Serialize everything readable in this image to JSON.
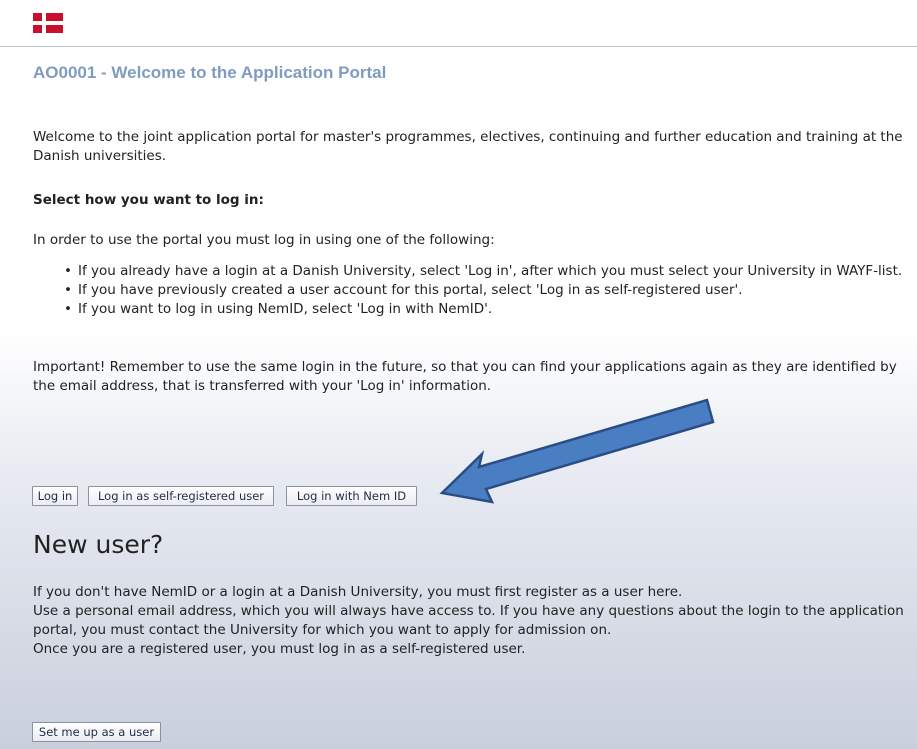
{
  "header": {
    "flag_icon": "denmark-flag-icon",
    "colors": {
      "flag_red": "#c8102e",
      "flag_white": "#ffffff"
    }
  },
  "page": {
    "title": "AO0001 - Welcome to the Application Portal",
    "intro": "Welcome to the joint application portal for master's programmes, electives, continuing and further education and training at the Danish universities.",
    "login_heading": "Select how you want to log in:",
    "instruction": "In order to use the portal you must log in using one of the following:",
    "options": [
      "If you already have a login at a Danish University, select 'Log in', after which you must select your University in WAYF-list.",
      "If you have previously created a user account for this portal, select 'Log in as self-registered user'.",
      "If you want to log in using NemID, select 'Log in with NemID'."
    ],
    "important": "Important! Remember to use the same login in the future, so that you can find your applications again as they are identified by the email address, that is transferred with your 'Log in' information."
  },
  "buttons": {
    "login": "Log in",
    "self_registered": "Log in as self-registered user",
    "nemid": "Log in with Nem ID"
  },
  "annotation": {
    "arrow_icon": "callout-arrow-icon",
    "color": "#4a7ec2"
  },
  "new_user": {
    "title": "New user?",
    "lines": [
      "If you don't have NemID or a login at a Danish University, you must first register as a user here.",
      "Use a personal email address, which you will always have access to. If you have any questions about the login to the application portal, you must contact the University for which you want to apply for admission on.",
      "Once you are a registered user, you must log in as a self-registered user."
    ],
    "setup_button": "Set me up as a user"
  }
}
